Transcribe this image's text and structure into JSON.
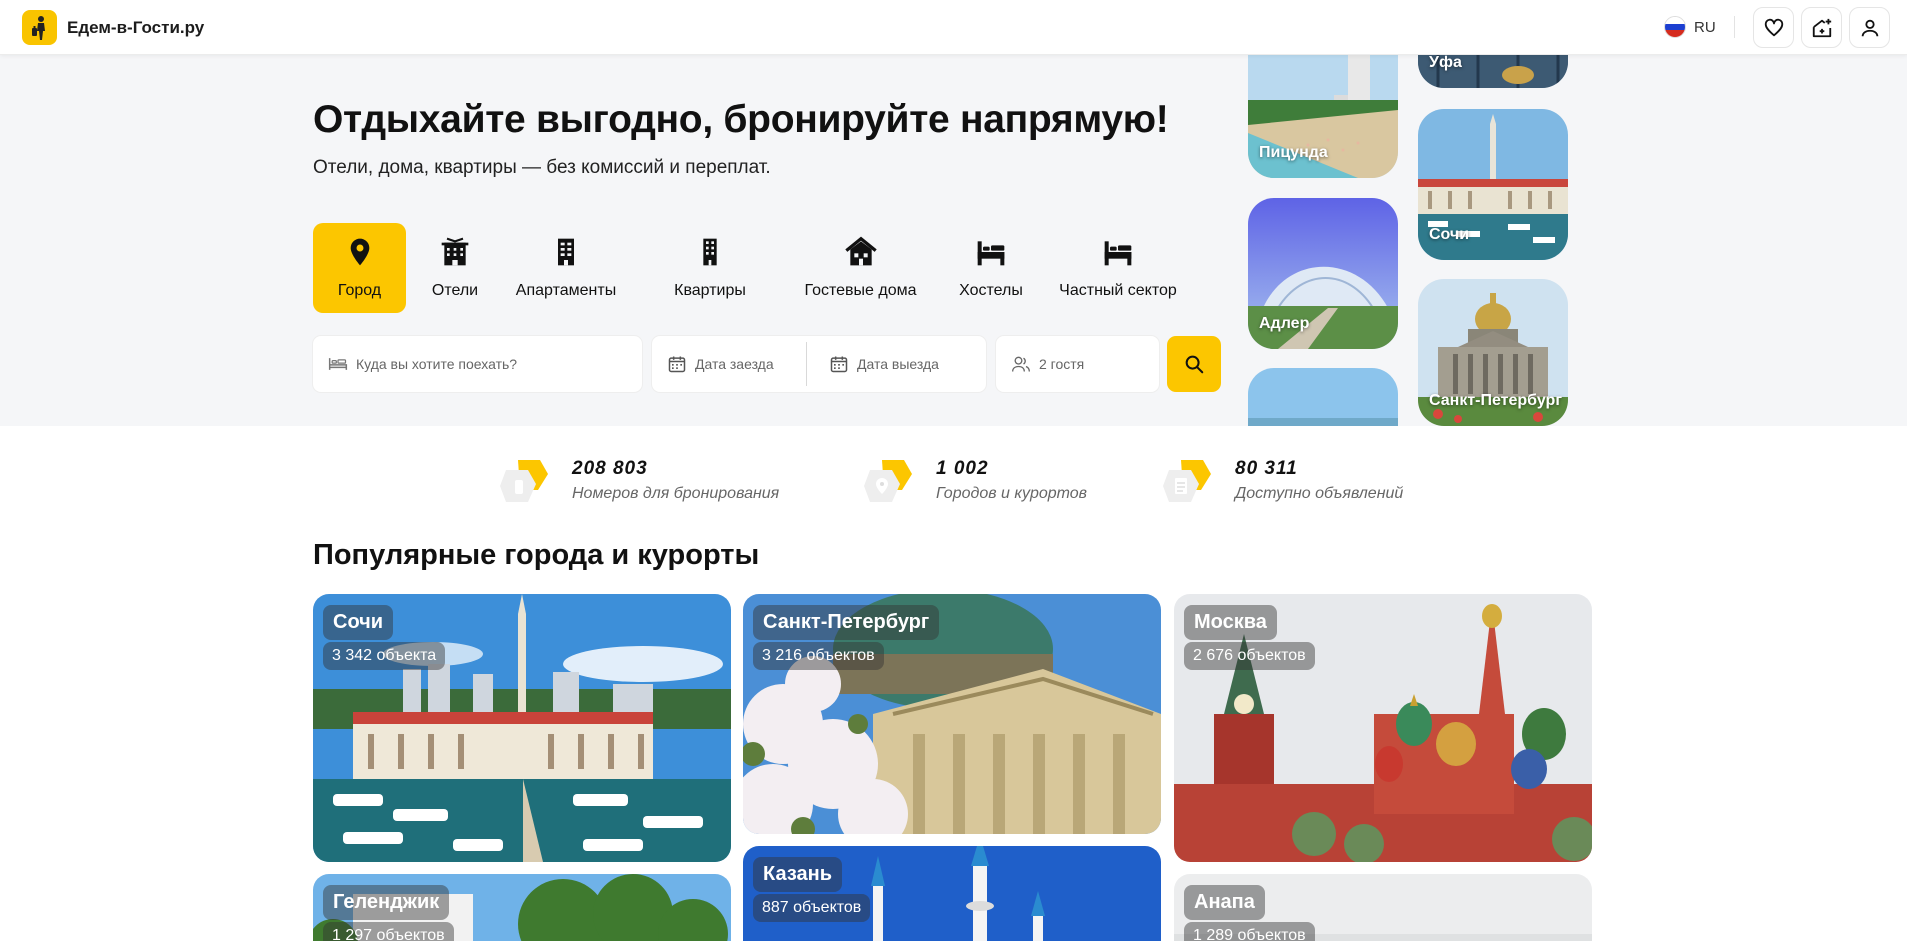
{
  "header": {
    "brand": "Едем-в-Гости.ру",
    "lang": "RU",
    "icons": [
      "logo-icon",
      "russia-flag-icon",
      "heart-icon",
      "add-listing-icon",
      "user-icon"
    ]
  },
  "hero": {
    "title": "Отдыхайте выгодно, бронируйте напрямую!",
    "subtitle": "Отели, дома, квартиры — без комиссий и переплат.",
    "categories": [
      {
        "label": "Город",
        "icon": "map-pin-icon"
      },
      {
        "label": "Отели",
        "icon": "hotel-icon"
      },
      {
        "label": "Апартаменты",
        "icon": "apartment-icon"
      },
      {
        "label": "Квартиры",
        "icon": "building-icon"
      },
      {
        "label": "Гостевые дома",
        "icon": "house-icon"
      },
      {
        "label": "Хостелы",
        "icon": "bed-icon"
      },
      {
        "label": "Частный сектор",
        "icon": "bed-icon"
      }
    ],
    "search": {
      "destination_placeholder": "Куда вы хотите поехать?",
      "checkin": "Дата заезда",
      "checkout": "Дата выезда",
      "guests": "2 гостя"
    },
    "tiles": [
      "Уфа",
      "Пицунда",
      "Сочи",
      "Адлер",
      "Санкт-Петербург"
    ]
  },
  "stats": [
    {
      "number": "208 803",
      "label": "Номеров для бронирования"
    },
    {
      "number": "1 002",
      "label": "Городов и курортов"
    },
    {
      "number": "80 311",
      "label": "Доступно объявлений"
    }
  ],
  "popular": {
    "title": "Популярные города и курорты",
    "cards": [
      {
        "name": "Сочи",
        "count": "3 342 объекта"
      },
      {
        "name": "Санкт-Петербург",
        "count": "3 216 объектов"
      },
      {
        "name": "Москва",
        "count": "2 676 объектов"
      },
      {
        "name": "Геленджик",
        "count": "1 297 объектов"
      },
      {
        "name": "Казань",
        "count": "887 объектов"
      },
      {
        "name": "Анапа",
        "count": "1 289 объектов"
      }
    ]
  },
  "colors": {
    "accent": "#fcc600",
    "hero_bg": "#f5f6f8"
  }
}
